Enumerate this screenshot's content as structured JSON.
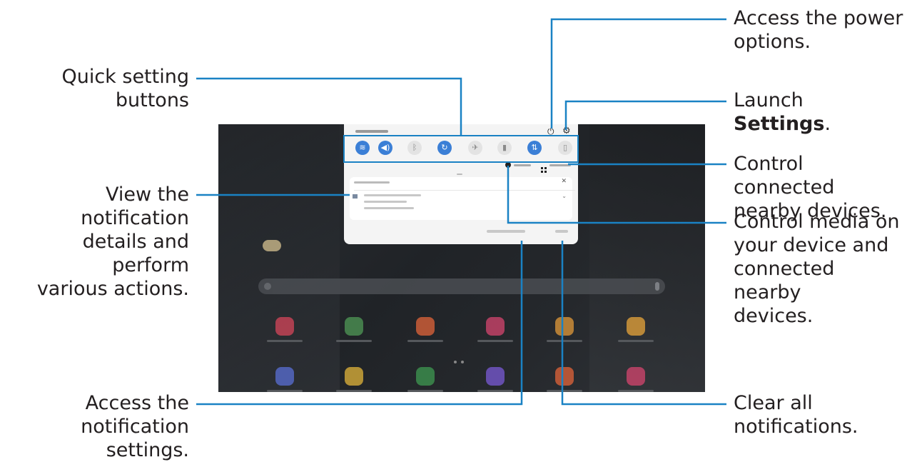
{
  "callouts": {
    "quick_setting_line1": "Quick setting",
    "quick_setting_line2": "buttons",
    "power_line1": "Access the power",
    "power_line2": "options.",
    "settings_prefix": "Launch ",
    "settings_bold": "Settings",
    "settings_suffix": ".",
    "nearby_line1": "Control connected",
    "nearby_line2": "nearby devices.",
    "notif_details_line1": "View the notification",
    "notif_details_line2": "details and perform",
    "notif_details_line3": "various actions.",
    "media_line1": "Control media on",
    "media_line2": "your device and",
    "media_line3": "connected nearby",
    "media_line4": "devices.",
    "notif_settings_line1": "Access the",
    "notif_settings_line2": "notification settings.",
    "clear_line1": "Clear all",
    "clear_line2": "notifications."
  },
  "panel": {
    "power_icon": "power-icon",
    "settings_icon": "gear-icon",
    "quick_settings": [
      {
        "icon": "wifi-icon",
        "glyph": "≋",
        "state": "on"
      },
      {
        "icon": "sound-icon",
        "glyph": "◀)",
        "state": "on"
      },
      {
        "icon": "bluetooth-icon",
        "glyph": "ᛒ",
        "state": "off"
      },
      {
        "icon": "auto-rotate-icon",
        "glyph": "↻",
        "state": "on"
      },
      {
        "icon": "airplane-icon",
        "glyph": "✈",
        "state": "off"
      },
      {
        "icon": "flashlight-icon",
        "glyph": "▮",
        "state": "off"
      },
      {
        "icon": "mobile-data-icon",
        "glyph": "⇅",
        "state": "on"
      },
      {
        "icon": "document-icon",
        "glyph": "▯",
        "state": "off"
      }
    ]
  },
  "colors": {
    "callout_line": "#1a82c4",
    "quick_setting_on": "#3b7fd6",
    "app_colors": [
      "#d6455a",
      "#4f9a57",
      "#e2643a",
      "#d6456f",
      "#e29a3a",
      "#e8a53b",
      "#5a6fd6",
      "#e2b43a",
      "#3f9a52",
      "#7a5ad6",
      "#e2643a",
      "#d6456f"
    ]
  }
}
